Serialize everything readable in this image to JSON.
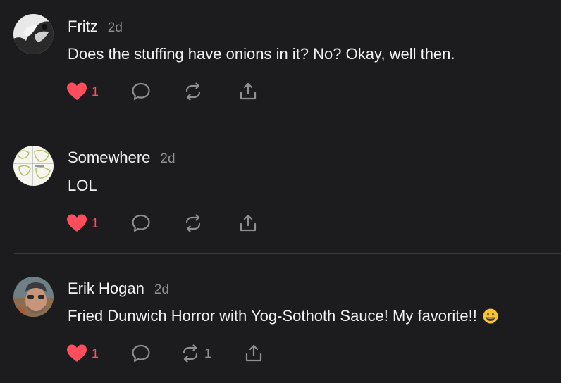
{
  "comments": [
    {
      "author": "Fritz",
      "time": "2d",
      "text": "Does the stuffing have onions in it? No? Okay, well then.",
      "likes": "1",
      "restacks": ""
    },
    {
      "author": "Somewhere",
      "time": "2d",
      "text": "LOL",
      "likes": "1",
      "restacks": ""
    },
    {
      "author": "Erik Hogan",
      "time": "2d",
      "text": "Fried Dunwich Horror with Yog-Sothoth Sauce! My favorite!!",
      "emoji": "grinning-face-emoji",
      "likes": "1",
      "restacks": "1"
    }
  ],
  "icons": {
    "like": "heart-filled-icon",
    "reply": "speech-bubble-icon",
    "restack": "restack-arrows-icon",
    "share": "share-upload-icon"
  },
  "colors": {
    "background": "#1c1c1e",
    "like": "#ff4d5e",
    "icon": "#8e8e93",
    "text": "#f2f2f2"
  }
}
